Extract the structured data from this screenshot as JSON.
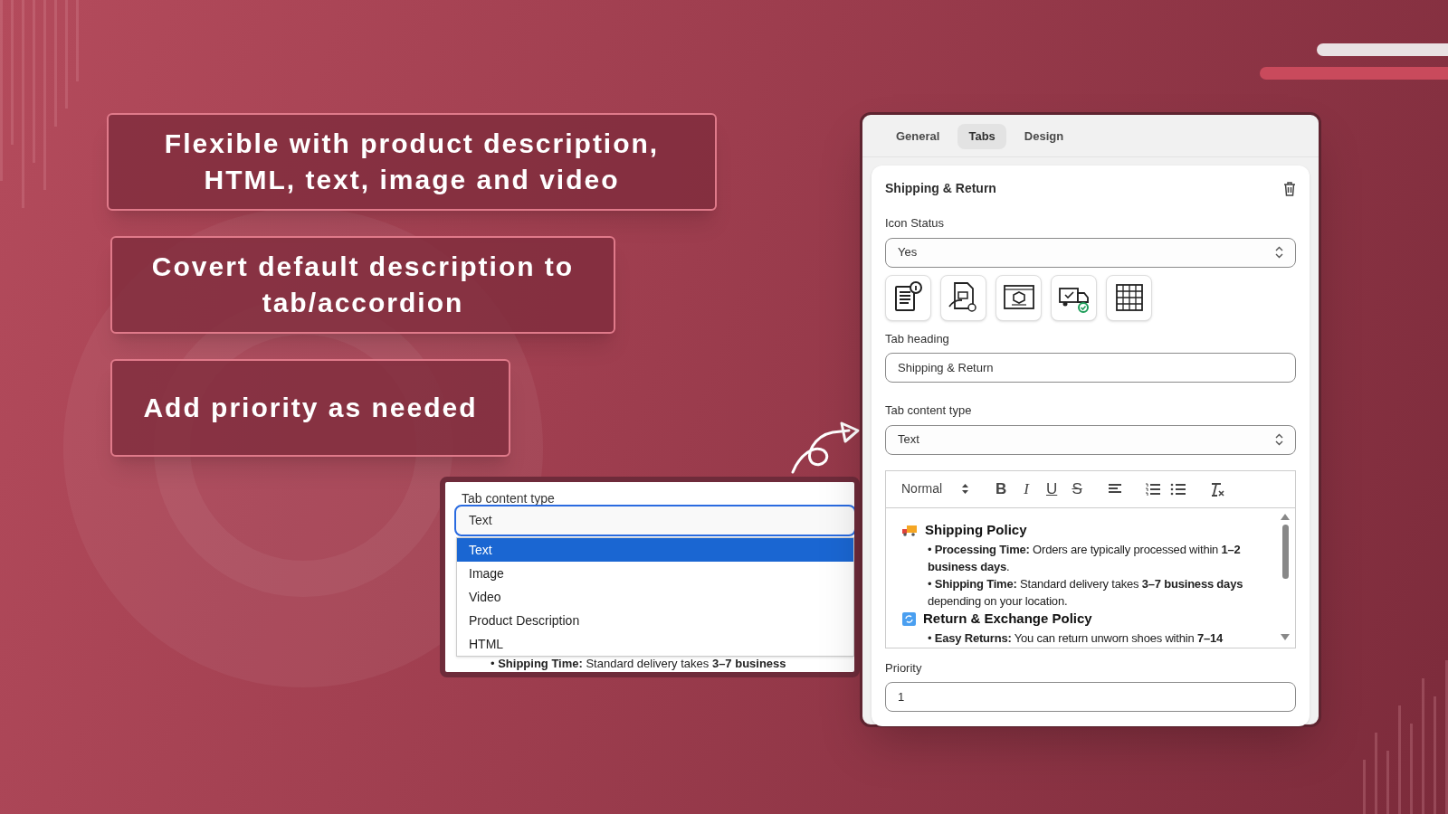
{
  "callouts": [
    {
      "text": "Flexible with product description, HTML, text, image and video"
    },
    {
      "text": "Covert default description to tab/accordion"
    },
    {
      "text": "Add priority as needed"
    }
  ],
  "dropdown_popup": {
    "label": "Tab content type",
    "value": "Text",
    "options": [
      {
        "label": "Text",
        "selected": true
      },
      {
        "label": "Image",
        "selected": false
      },
      {
        "label": "Video",
        "selected": false
      },
      {
        "label": "Product Description",
        "selected": false
      },
      {
        "label": "HTML",
        "selected": false
      }
    ],
    "behind_text": "• **Shipping Time:** Standard delivery takes **3–7 business**"
  },
  "panel": {
    "tabs": [
      {
        "label": "General",
        "selected": false
      },
      {
        "label": "Tabs",
        "selected": true
      },
      {
        "label": "Design",
        "selected": false
      }
    ],
    "card": {
      "title": "Shipping & Return",
      "icon_status": {
        "label": "Icon Status",
        "value": "Yes"
      },
      "tab_heading": {
        "label": "Tab heading",
        "value": "Shipping & Return"
      },
      "content_type": {
        "label": "Tab content type",
        "value": "Text"
      },
      "editor": {
        "format": "Normal",
        "toolbar": [
          {
            "kind": "bold",
            "glyph": "B"
          },
          {
            "kind": "italic",
            "glyph": "I"
          },
          {
            "kind": "underline",
            "glyph": "U"
          },
          {
            "kind": "strike",
            "glyph": "S"
          },
          {
            "kind": "align"
          },
          {
            "kind": "ordered-list"
          },
          {
            "kind": "bullet-list"
          },
          {
            "kind": "clean"
          }
        ],
        "blocks": [
          {
            "kind": "heading",
            "text": "Shipping Policy"
          },
          {
            "kind": "bullet",
            "text": "• **Processing Time:** Orders are typically processed within **1–2 business days**."
          },
          {
            "kind": "bullet",
            "text": "• **Shipping Time:** Standard delivery takes **3–7 business days** depending on your location."
          },
          {
            "kind": "heading",
            "text": "Return & Exchange Policy"
          },
          {
            "kind": "bullet",
            "text": "• **Easy Returns:** You can return unworn shoes within **7–14**"
          }
        ]
      },
      "priority": {
        "label": "Priority",
        "value": "1"
      }
    }
  }
}
